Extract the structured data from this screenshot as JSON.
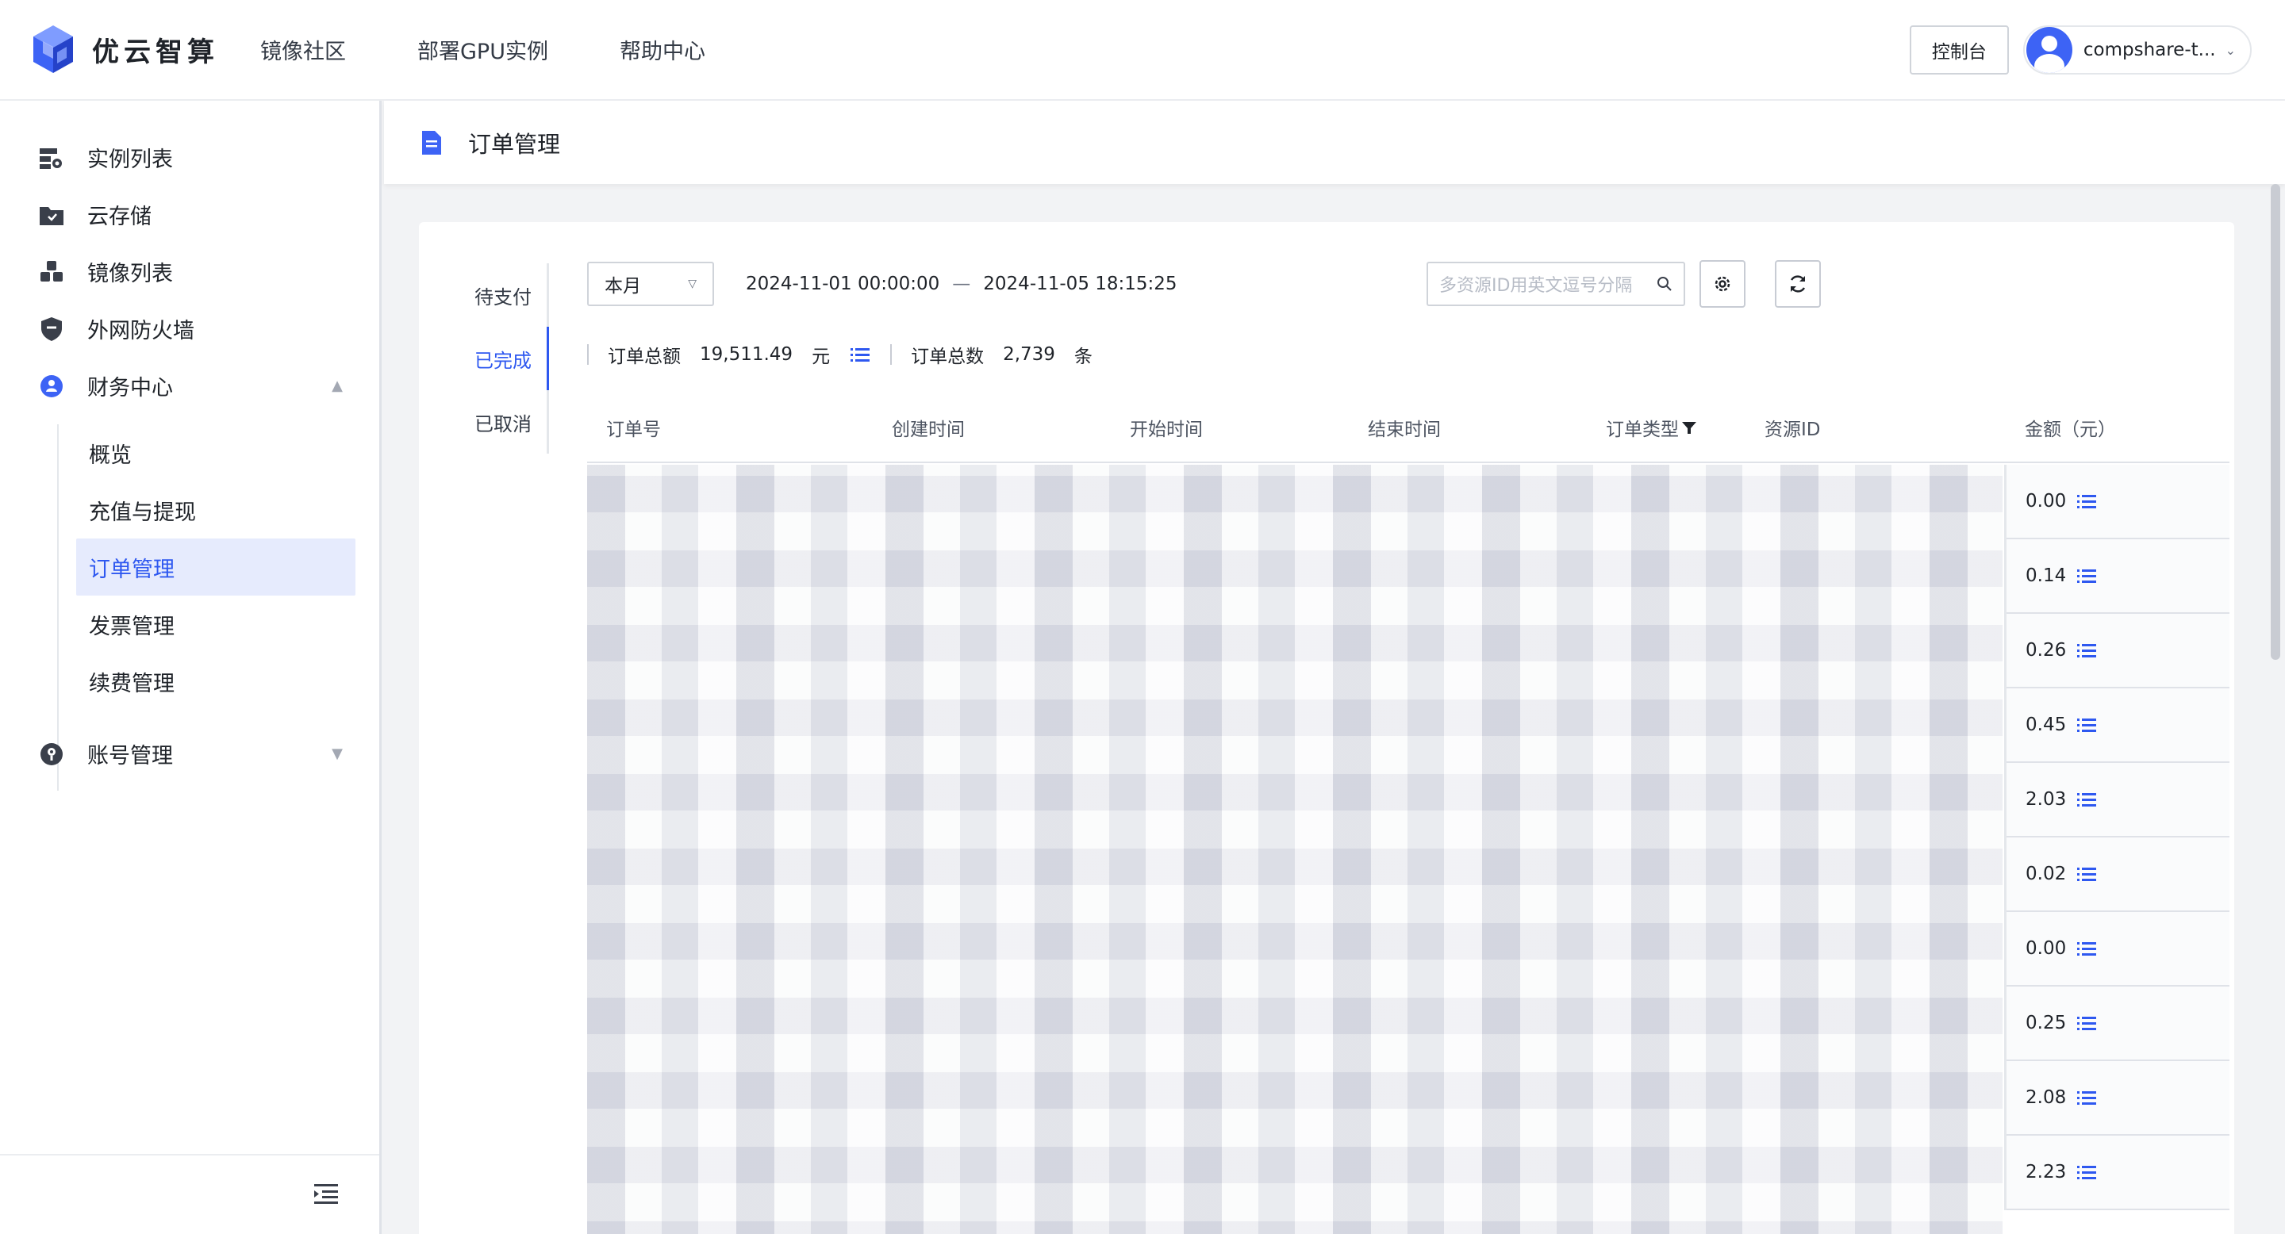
{
  "brand": {
    "name": "优云智算"
  },
  "topnav": {
    "items": [
      "镜像社区",
      "部署GPU实例",
      "帮助中心"
    ]
  },
  "header_right": {
    "console_label": "控制台",
    "user_name": "compshare-t..."
  },
  "sidebar": {
    "items": [
      {
        "label": "实例列表",
        "icon": "server-icon"
      },
      {
        "label": "云存储",
        "icon": "folder-icon"
      },
      {
        "label": "镜像列表",
        "icon": "cubes-icon"
      },
      {
        "label": "外网防火墙",
        "icon": "shield-icon"
      },
      {
        "label": "财务中心",
        "icon": "finance-icon"
      },
      {
        "label": "账号管理",
        "icon": "account-icon"
      }
    ],
    "finance_sub": [
      "概览",
      "充值与提现",
      "订单管理",
      "发票管理",
      "续费管理"
    ],
    "active_sub": "订单管理"
  },
  "page": {
    "title": "订单管理"
  },
  "status_tabs": [
    "待支付",
    "已完成",
    "已取消"
  ],
  "filters": {
    "period": "本月",
    "date_start": "2024-11-01 00:00:00",
    "date_sep": "—",
    "date_end": "2024-11-05 18:15:25",
    "search_placeholder": "多资源ID用英文逗号分隔"
  },
  "summary": {
    "total_amount_label": "订单总额",
    "total_amount": "19,511.49",
    "amount_unit": "元",
    "total_count_label": "订单总数",
    "total_count": "2,739",
    "count_unit": "条"
  },
  "table": {
    "columns": [
      "订单号",
      "创建时间",
      "开始时间",
      "结束时间",
      "订单类型",
      "资源ID",
      "金额（元）"
    ],
    "amounts": [
      "0.00",
      "0.14",
      "0.26",
      "0.45",
      "2.03",
      "0.02",
      "0.00",
      "0.25",
      "2.08",
      "2.23"
    ]
  },
  "colors": {
    "primary": "#2e58f0",
    "active_bg": "#e6ebfd"
  }
}
